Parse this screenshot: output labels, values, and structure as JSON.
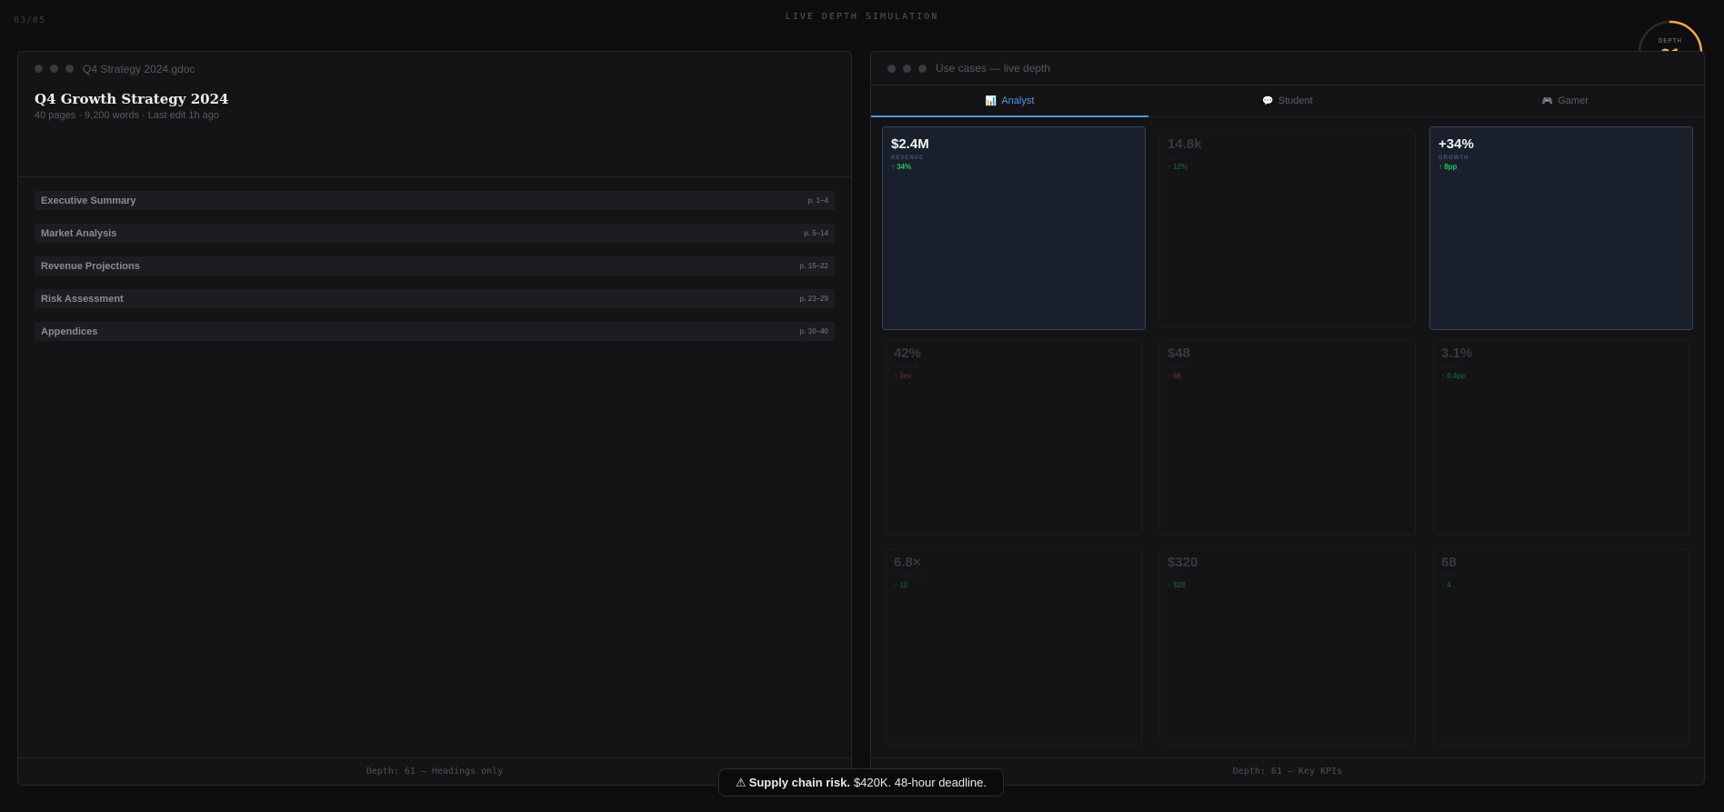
{
  "slide_counter": "03/05",
  "top_label": "LIVE DEPTH SIMULATION",
  "depth_gauge": {
    "label": "DEPTH",
    "value": "61",
    "fill_fraction": 0.61,
    "color": "#f0a84a"
  },
  "left_panel": {
    "window_title": "Q4 Strategy 2024.gdoc",
    "doc_title": "Q4 Growth Strategy 2024",
    "doc_meta": "40 pages · 9,200 words · Last edit 1h ago",
    "sections": [
      {
        "title": "Executive Summary",
        "pages": "p. 1–4"
      },
      {
        "title": "Market Analysis",
        "pages": "p. 5–14"
      },
      {
        "title": "Revenue Projections",
        "pages": "p. 15–22"
      },
      {
        "title": "Risk Assessment",
        "pages": "p. 23–29"
      },
      {
        "title": "Appendices",
        "pages": "p. 30–40"
      }
    ],
    "footer": "Depth: 61 — Headings only"
  },
  "right_panel": {
    "window_title": "Use cases — live depth",
    "tabs": [
      {
        "label": "Analyst",
        "icon": "chart-icon",
        "glyph": "📊",
        "active": true
      },
      {
        "label": "Student",
        "icon": "chat-icon",
        "glyph": "💬",
        "active": false
      },
      {
        "label": "Gamer",
        "icon": "gamepad-icon",
        "glyph": "🎮",
        "active": false
      }
    ],
    "kpis": [
      {
        "value": "$2.4M",
        "label": "REVENUE",
        "delta": "↑ 34%",
        "trend": "up",
        "state": "highlight"
      },
      {
        "value": "14.8k",
        "label": "USERS",
        "delta": "↑ 12%",
        "trend": "up",
        "state": "dim"
      },
      {
        "value": "+34%",
        "label": "GROWTH",
        "delta": "↑ 8pp",
        "trend": "up",
        "state": "highlight"
      },
      {
        "value": "42%",
        "label": "CHURN",
        "delta": "↑ 3ex",
        "trend": "down",
        "state": "dim"
      },
      {
        "value": "$48",
        "label": "ARPU",
        "delta": "↑ $6",
        "trend": "down",
        "state": "dim"
      },
      {
        "value": "3.1%",
        "label": "CONV",
        "delta": "↑ 0.4pp",
        "trend": "up",
        "state": "dim"
      },
      {
        "value": "6.8×",
        "label": "LTV/CAC",
        "delta": "↑ 12",
        "trend": "up",
        "state": "dim"
      },
      {
        "value": "$320",
        "label": "LTV",
        "delta": "↑ $28",
        "trend": "up",
        "state": "dim"
      },
      {
        "value": "68",
        "label": "NPS",
        "delta": "↑ 4",
        "trend": "up",
        "state": "dim"
      }
    ],
    "footer": "Depth: 61 — Key KPIs"
  },
  "toast": {
    "icon": "warning-icon",
    "glyph": "⚠",
    "bold": "Supply chain risk.",
    "text": "$420K. 48-hour deadline."
  }
}
